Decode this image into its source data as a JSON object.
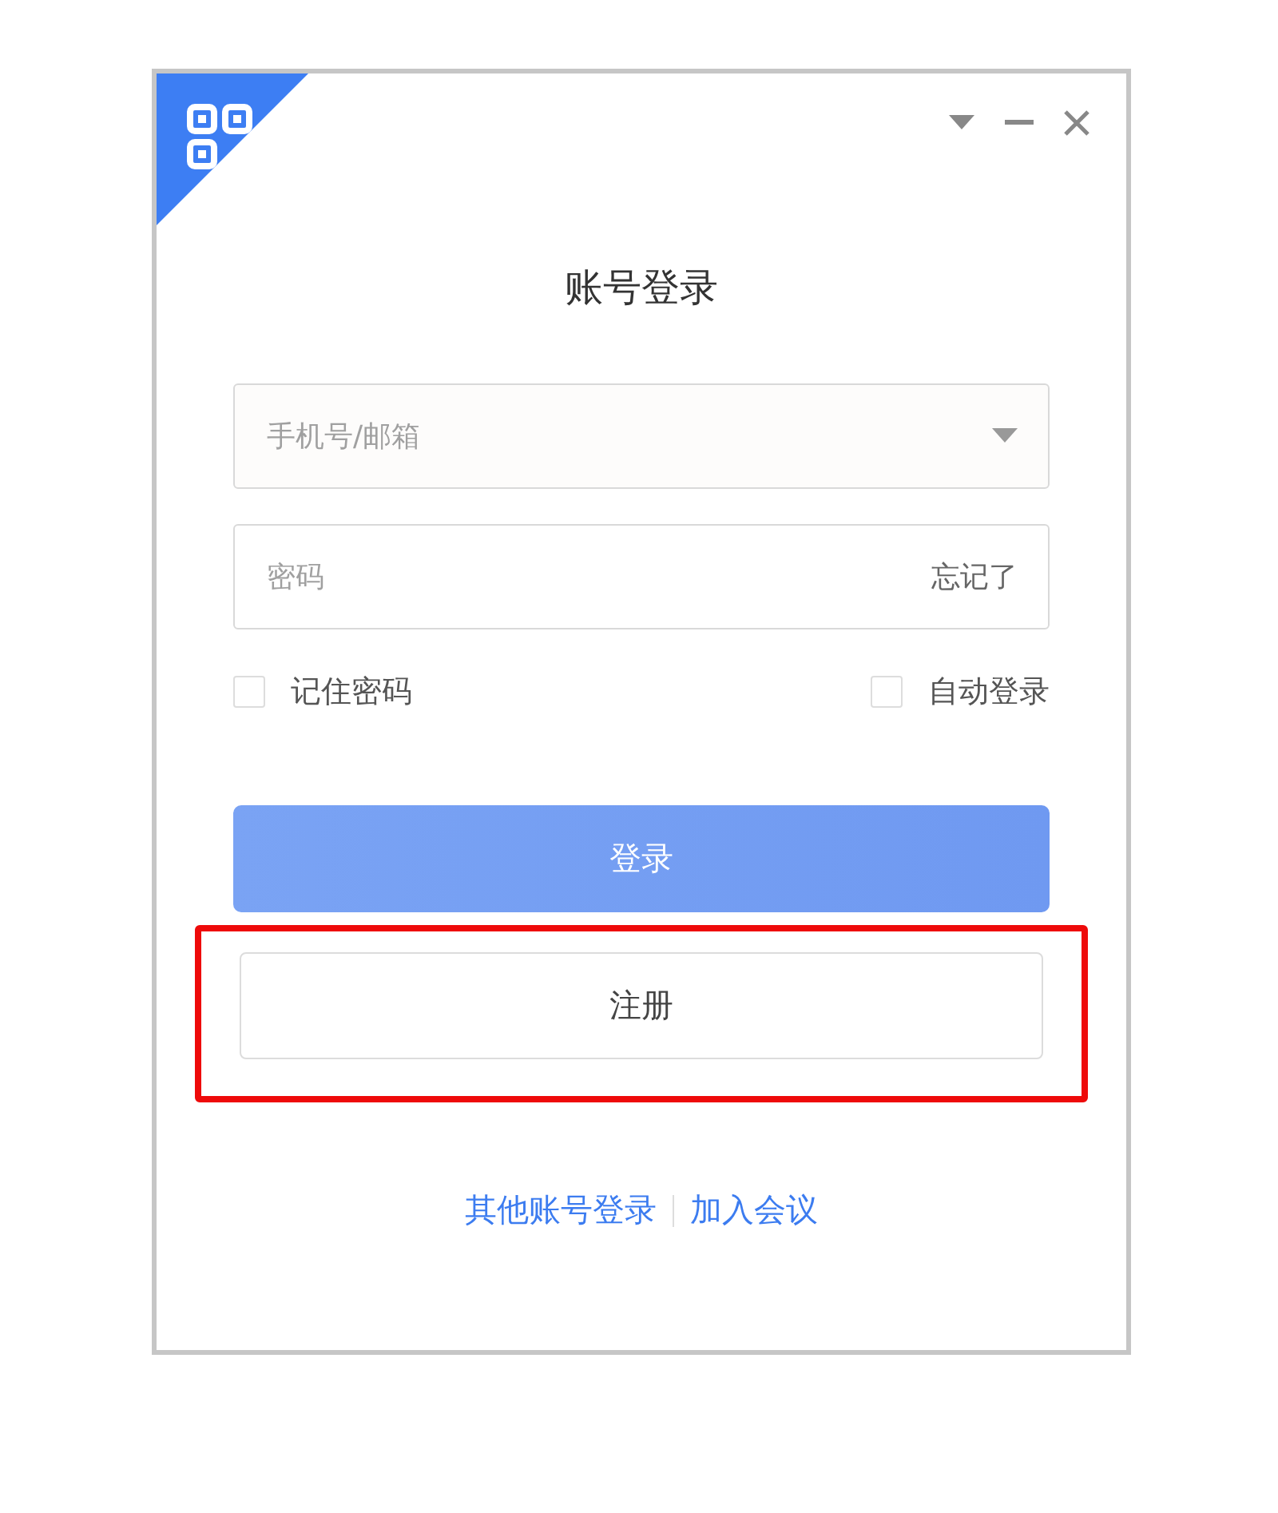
{
  "window": {
    "title": "账号登录"
  },
  "account_field": {
    "placeholder": "手机号/邮箱"
  },
  "password_field": {
    "placeholder": "密码",
    "forgot_link": "忘记了"
  },
  "options": [
    {
      "label": "记住密码",
      "checked": false
    },
    {
      "label": "自动登录",
      "checked": false
    }
  ],
  "login_button": {
    "label": "登录",
    "disabled": true
  },
  "register_button": {
    "label": "注册",
    "highlighted": true
  },
  "footer_links": [
    "其他账号登录",
    "加入会议"
  ]
}
